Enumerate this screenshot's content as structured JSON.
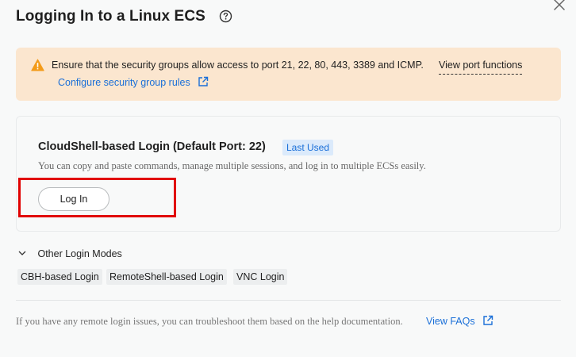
{
  "dialog": {
    "title": "Logging In to a Linux ECS"
  },
  "alert": {
    "message": "Ensure that the security groups allow access to port 21, 22, 80, 443, 3389 and ICMP.",
    "port_functions_link": "View port functions",
    "configure_link": "Configure security group rules"
  },
  "cloudshell": {
    "title": "CloudShell-based Login (Default Port: 22)",
    "badge": "Last Used",
    "description": "You can copy and paste commands, manage multiple sessions, and log in to multiple ECSs easily.",
    "login_button": "Log In"
  },
  "other_modes": {
    "label": "Other Login Modes",
    "modes": [
      "CBH-based Login",
      "RemoteShell-based Login",
      "VNC Login"
    ]
  },
  "footer": {
    "text": "If you have any remote login issues, you can troubleshoot them based on the help documentation.",
    "faq_link": "View FAQs"
  },
  "colors": {
    "accent": "#1a6fd8",
    "warning_bg": "#fbe6cf",
    "warning_icon": "#f39b19",
    "highlight": "#e10000"
  },
  "icons": [
    "help-icon",
    "close-icon",
    "warning-icon",
    "external-link-icon",
    "chevron-down-icon"
  ]
}
